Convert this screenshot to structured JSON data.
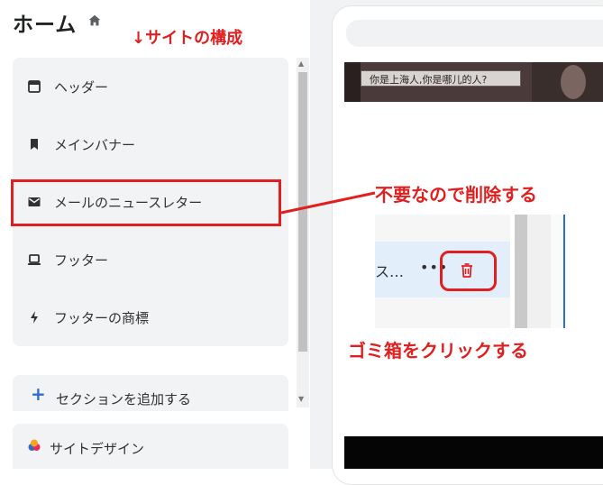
{
  "header": {
    "title": "ホーム",
    "home_icon": "home-icon"
  },
  "annotations": {
    "structure": "↓サイトの構成",
    "delete_note": "不要なので削除する",
    "click_note": "ゴミ箱をクリックする",
    "color": "#e02020"
  },
  "sidebar": {
    "items": [
      {
        "label": "ヘッダー",
        "icon": "header-layout-icon"
      },
      {
        "label": "メインバナー",
        "icon": "bookmark-icon"
      },
      {
        "label": "メールのニュースレター",
        "icon": "mail-icon"
      },
      {
        "label": "フッター",
        "icon": "laptop-icon"
      },
      {
        "label": "フッターの商標",
        "icon": "bolt-icon"
      }
    ],
    "add_section": "セクションを追加する",
    "site_design": "サイトデザイン",
    "accent": "#2c6ecb"
  },
  "preview": {
    "banner_text": "你是上海人,你是哪儿的人?",
    "row_text": "ス…",
    "more_label": "•••",
    "delete_icon": "trash-icon"
  }
}
